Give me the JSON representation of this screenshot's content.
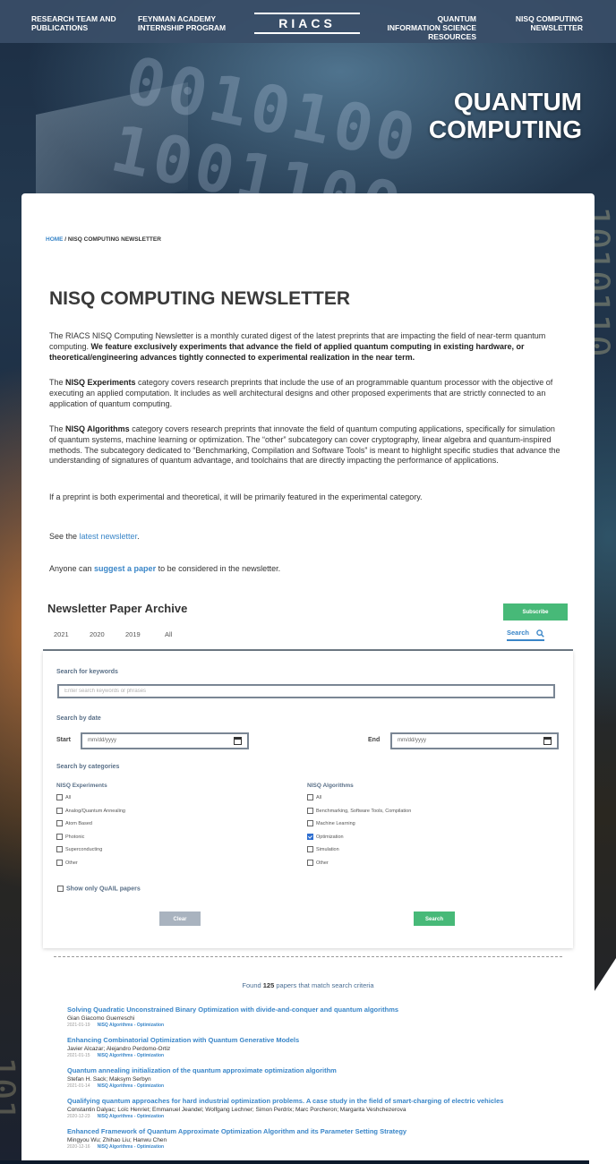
{
  "nav": {
    "items": [
      {
        "label": "Research Team and Publications"
      },
      {
        "label": "Feynman Academy Internship Program"
      },
      {
        "label": "Quantum Information Science Resources"
      },
      {
        "label": "NISQ Computing Newsletter"
      }
    ],
    "logo": "RIACS"
  },
  "hero": {
    "line1": "Quantum",
    "line2": "Computing"
  },
  "breadcrumb": {
    "home": "HOME",
    "separator": " / ",
    "current": "NISQ COMPUTING NEWSLETTER"
  },
  "page_title": "NISQ COMPUTING NEWSLETTER",
  "intro": {
    "p1_a": "The RIACS NISQ Computing Newsletter is a monthly curated digest of the latest preprints that are impacting the field of near-term quantum computing. ",
    "p1_b": "We feature exclusively experiments that advance the field of applied quantum computing in existing hardware, or theoretical/engineering advances tightly connected to experimental realization in the near term.",
    "p2_a": "The ",
    "p2_b": "NISQ Experiments",
    "p2_c": " category covers research preprints that include the use of an programmable quantum processor with the objective of executing an applied computation. It includes as well architectural designs and other proposed experiments that are strictly connected to an application of quantum computing.",
    "p3_a": "The ",
    "p3_b": "NISQ Algorithms",
    "p3_c": " category covers research preprints that innovate the field of quantum computing applications, specifically for simulation of quantum systems, machine learning or optimization. The “other” subcategory can cover cryptography, linear algebra and quantum-inspired methods. The subcategory dedicated to “Benchmarking, Compilation and Software Tools” is meant to highlight specific studies that advance the understanding of signatures of quantum advantage, and toolchains that are directly impacting the performance of applications.",
    "p4": "If a preprint is both experimental and theoretical, it will be primarily featured in the experimental category.",
    "p5_a": "See the ",
    "p5_link": "latest newsletter",
    "p5_b": ".",
    "p6_a": "Anyone can ",
    "p6_link": "suggest a paper",
    "p6_b": " to be considered in the newsletter."
  },
  "archive": {
    "title": "Newsletter Paper Archive",
    "subscribe_label": "Subscribe",
    "tabs": [
      "2021",
      "2020",
      "2019",
      "All"
    ],
    "search_tab": "Search"
  },
  "form": {
    "keywords_label": "Search for keywords",
    "keywords_placeholder": "Enter search keywords or phrases",
    "date_label": "Search by date",
    "start_label": "Start",
    "end_label": "End",
    "date_placeholder": "mm/dd/yyyy",
    "categories_label": "Search by categories",
    "experiments": {
      "heading": "NISQ Experiments",
      "options": [
        {
          "label": "All",
          "checked": false
        },
        {
          "label": "Analog/Quantum Annealing",
          "checked": false
        },
        {
          "label": "Atom Based",
          "checked": false
        },
        {
          "label": "Photonic",
          "checked": false
        },
        {
          "label": "Superconducting",
          "checked": false
        },
        {
          "label": "Other",
          "checked": false
        }
      ]
    },
    "algorithms": {
      "heading": "NISQ Algorithms",
      "options": [
        {
          "label": "All",
          "checked": false
        },
        {
          "label": "Benchmarking, Software Tools, Compilation",
          "checked": false
        },
        {
          "label": "Machine Learning",
          "checked": false
        },
        {
          "label": "Optimization",
          "checked": true
        },
        {
          "label": "Simulation",
          "checked": false
        },
        {
          "label": "Other",
          "checked": false
        }
      ]
    },
    "quail_label": "Show only QuAIL papers",
    "clear_label": "Clear",
    "search_label": "Search"
  },
  "results": {
    "found_prefix": "Found ",
    "count": "125",
    "found_suffix": " papers that match search criteria",
    "items": [
      {
        "title": "Solving Quadratic Unconstrained Binary Optimization with divide-and-conquer and quantum algorithms",
        "authors": "Gian Giacomo Guerreschi",
        "date": "2021-01-19",
        "category": "NISQ Algorithms - Optimization"
      },
      {
        "title": "Enhancing Combinatorial Optimization with Quantum Generative Models",
        "authors": "Javier Alcazar; Alejandro Perdomo-Ortiz",
        "date": "2021-01-15",
        "category": "NISQ Algorithms - Optimization"
      },
      {
        "title": "Quantum annealing initialization of the quantum approximate optimization algorithm",
        "authors": "Stefan H. Sack; Maksym Serbyn",
        "date": "2021-01-14",
        "category": "NISQ Algorithms - Optimization"
      },
      {
        "title": "Qualifying quantum approaches for hard industrial optimization problems. A case study in the field of smart-charging of electric vehicles",
        "authors": "Constantin Dalyac; Loïc Henriet; Emmanuel Jeandel; Wolfgang Lechner; Simon Perdrix; Marc Porcheron; Margarita Veshchezerova",
        "date": "2020-12-23",
        "category": "NISQ Algorithms - Optimization"
      },
      {
        "title": "Enhanced Framework of Quantum Approximate Optimization Algorithm and its Parameter Setting Strategy",
        "authors": "Mingyou Wu; Zhihao Liu; Hanwu Chen",
        "date": "2020-12-16",
        "category": "NISQ Algorithms - Optimization"
      }
    ]
  }
}
